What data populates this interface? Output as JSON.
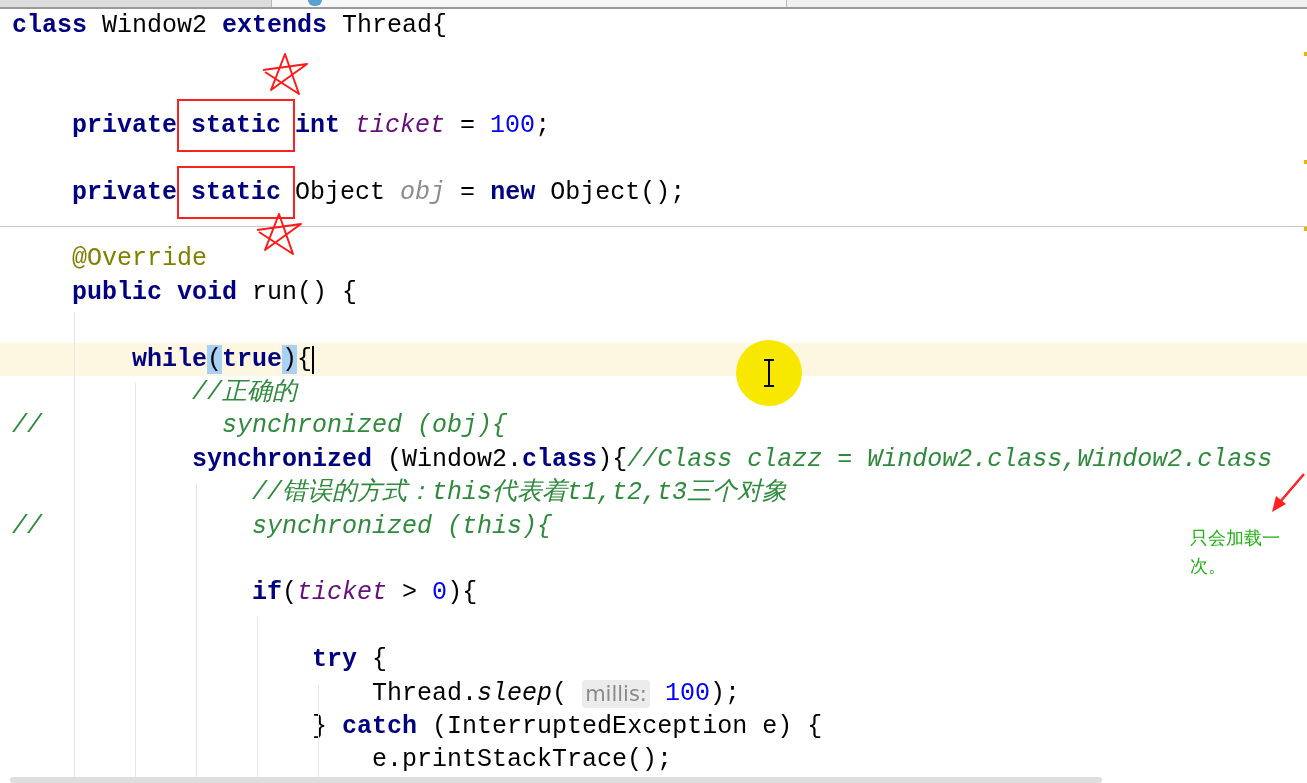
{
  "editor": {
    "lines": [
      {
        "kind": "code",
        "current": false,
        "tokens": [
          {
            "text": "class ",
            "kind": "keyword"
          },
          {
            "text": "Window2 ",
            "kind": "plain"
          },
          {
            "text": "extends ",
            "kind": "keyword"
          },
          {
            "text": "Thread{",
            "kind": "plain"
          }
        ]
      },
      {
        "kind": "blank"
      },
      {
        "kind": "blank"
      },
      {
        "kind": "code",
        "current": false,
        "tokens": [
          {
            "text": "    private",
            "kind": "keyword"
          },
          {
            "text": "static",
            "kind": "keyword",
            "outlined": true
          },
          {
            "text": "int ",
            "kind": "keyword"
          },
          {
            "text": "ticket",
            "kind": "field"
          },
          {
            "text": " = ",
            "kind": "plain"
          },
          {
            "text": "100",
            "kind": "number"
          },
          {
            "text": ";",
            "kind": "plain"
          }
        ]
      },
      {
        "kind": "blank"
      },
      {
        "kind": "code",
        "current": false,
        "tokens": [
          {
            "text": "    private",
            "kind": "keyword"
          },
          {
            "text": "static",
            "kind": "keyword",
            "outlined": true
          },
          {
            "text": "Object ",
            "kind": "plain"
          },
          {
            "text": "obj",
            "kind": "unused"
          },
          {
            "text": " = ",
            "kind": "plain"
          },
          {
            "text": "new ",
            "kind": "keyword"
          },
          {
            "text": "Object();",
            "kind": "plain"
          }
        ]
      },
      {
        "kind": "separator"
      },
      {
        "kind": "code",
        "current": false,
        "tokens": [
          {
            "text": "    @Override",
            "kind": "annotation"
          }
        ]
      },
      {
        "kind": "code",
        "current": false,
        "tokens": [
          {
            "text": "    public void ",
            "kind": "keyword"
          },
          {
            "text": "run() {",
            "kind": "plain"
          }
        ]
      },
      {
        "kind": "blank"
      },
      {
        "kind": "code",
        "current": true,
        "tokens": [
          {
            "text": "        while",
            "kind": "keyword"
          },
          {
            "text": "(",
            "kind": "match"
          },
          {
            "text": "true",
            "kind": "keyword"
          },
          {
            "text": ")",
            "kind": "match"
          },
          {
            "text": "{",
            "kind": "plain"
          }
        ]
      },
      {
        "kind": "code",
        "current": false,
        "tokens": [
          {
            "text": "            //正确的",
            "kind": "comment"
          }
        ]
      },
      {
        "kind": "code",
        "current": false,
        "tokens": [
          {
            "text": "//            synchronized (obj){",
            "kind": "comment"
          }
        ]
      },
      {
        "kind": "code",
        "current": false,
        "tokens": [
          {
            "text": "            synchronized ",
            "kind": "keyword"
          },
          {
            "text": "(Window2.",
            "kind": "plain"
          },
          {
            "text": "class",
            "kind": "keyword"
          },
          {
            "text": "){",
            "kind": "plain"
          },
          {
            "text": "//Class clazz = Window2.class,Window2.class",
            "kind": "comment"
          }
        ]
      },
      {
        "kind": "code",
        "current": false,
        "tokens": [
          {
            "text": "                //错误的方式：this代表着t1,t2,t3三个对象",
            "kind": "comment"
          }
        ]
      },
      {
        "kind": "code",
        "current": false,
        "tokens": [
          {
            "text": "//              synchronized (this){",
            "kind": "comment"
          }
        ]
      },
      {
        "kind": "blank"
      },
      {
        "kind": "code",
        "current": false,
        "tokens": [
          {
            "text": "                if",
            "kind": "keyword"
          },
          {
            "text": "(",
            "kind": "plain"
          },
          {
            "text": "ticket",
            "kind": "field"
          },
          {
            "text": " > ",
            "kind": "plain"
          },
          {
            "text": "0",
            "kind": "number"
          },
          {
            "text": "){",
            "kind": "plain"
          }
        ]
      },
      {
        "kind": "blank"
      },
      {
        "kind": "code",
        "current": false,
        "tokens": [
          {
            "text": "                    try ",
            "kind": "keyword"
          },
          {
            "text": "{",
            "kind": "plain"
          }
        ]
      },
      {
        "kind": "code",
        "current": false,
        "tokens": [
          {
            "text": "                        Thread.",
            "kind": "plain"
          },
          {
            "text": "sleep",
            "kind": "static_method"
          },
          {
            "text": "( ",
            "kind": "plain"
          },
          {
            "text": "millis:",
            "kind": "hint"
          },
          {
            "text": " 100",
            "kind": "number"
          },
          {
            "text": ");",
            "kind": "plain"
          }
        ]
      },
      {
        "kind": "code",
        "current": false,
        "tokens": [
          {
            "text": "                    } ",
            "kind": "plain"
          },
          {
            "text": "catch ",
            "kind": "keyword"
          },
          {
            "text": "(InterruptedException e) {",
            "kind": "plain"
          }
        ]
      },
      {
        "kind": "code",
        "current": false,
        "tokens": [
          {
            "text": "                        e.printStackTrace();",
            "kind": "plain"
          }
        ]
      }
    ]
  },
  "markup": [
    {
      "kind": "star"
    },
    {
      "kind": "star"
    },
    {
      "kind": "arrow"
    }
  ],
  "note": {
    "text": "只会加载一次。"
  }
}
